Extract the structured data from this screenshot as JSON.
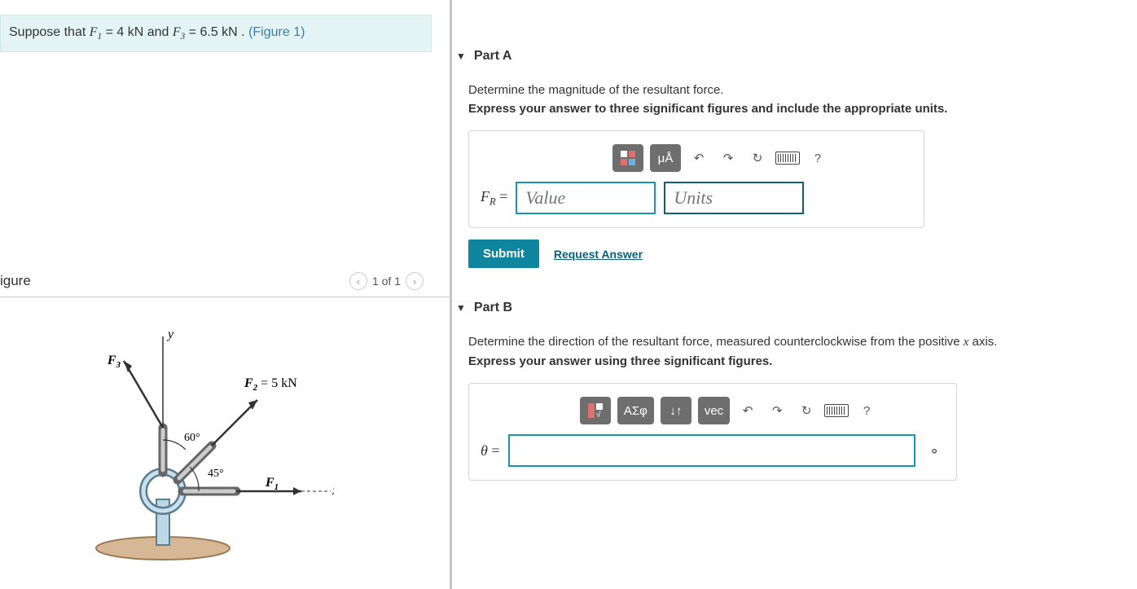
{
  "problem": {
    "prefix": "Suppose that ",
    "f1_name": "F",
    "f1_sub": "1",
    "f1_eq": " = 4  kN",
    "and": " and ",
    "f3_name": "F",
    "f3_sub": "3",
    "f3_eq": " = 6.5  kN",
    "suffix": " . ",
    "figlink": "(Figure 1)"
  },
  "figure": {
    "title": "igure",
    "prev": "‹",
    "pager": "1 of 1",
    "next": "›",
    "labels": {
      "y": "y",
      "x": "x",
      "F1": "F",
      "F1_sub": "1",
      "F2": "F",
      "F2_sub": "2",
      "F2_eq": " = 5 kN",
      "F3": "F",
      "F3_sub": "3",
      "ang60": "60°",
      "ang45": "45°"
    }
  },
  "partA": {
    "title": "Part A",
    "instr1": "Determine the magnitude of the resultant force.",
    "instr2": "Express your answer to three significant figures and include the appropriate units.",
    "toolbar": {
      "units_hint": "μÅ",
      "undo": "↶",
      "redo": "↷",
      "reset": "↻",
      "help": "?"
    },
    "label_var": "F",
    "label_sub": "R",
    "label_eq": " = ",
    "value_placeholder": "Value",
    "units_placeholder": "Units",
    "submit": "Submit",
    "request": "Request Answer"
  },
  "partB": {
    "title": "Part B",
    "instr1_a": "Determine the direction of the resultant force, measured counterclockwise from the positive ",
    "instr1_axis": "x",
    "instr1_b": " axis.",
    "instr2": "Express your answer using three significant figures.",
    "toolbar": {
      "greek": "ΑΣφ",
      "subsup": "↓↑",
      "vec": "vec",
      "undo": "↶",
      "redo": "↷",
      "reset": "↻",
      "help": "?"
    },
    "label_var": "θ",
    "label_eq": " = ",
    "deg": "∘"
  }
}
